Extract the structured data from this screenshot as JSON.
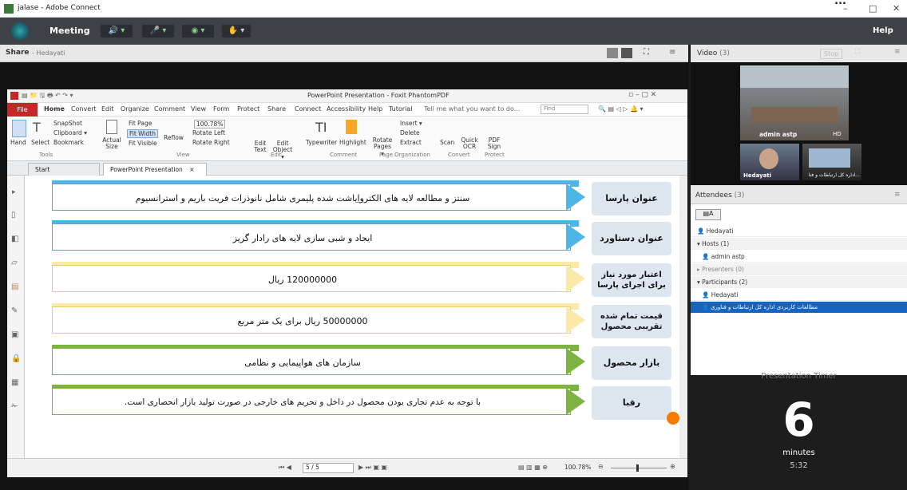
{
  "banner": {
    "text": "..."
  },
  "window": {
    "title": "jalase - Adobe Connect",
    "min": "–",
    "max": "□",
    "close": "✕"
  },
  "menubar": {
    "meeting": "Meeting",
    "help": "Help"
  },
  "share": {
    "title": "Share",
    "presenter": "- Hedayati"
  },
  "foxit": {
    "title": "PowerPoint Presentation - Foxit PhantomPDF",
    "tabs": [
      "File",
      "Home",
      "Convert",
      "Edit",
      "Organize",
      "Comment",
      "View",
      "Form",
      "Protect",
      "Share",
      "Connect",
      "Accessibility",
      "Help",
      "Tutorial"
    ],
    "tell_me": "Tell me what you want to do...",
    "find": "Find",
    "ribbon": {
      "hand": "Hand",
      "select": "Select",
      "snapshot": "SnapShot",
      "clipboard": "Clipboard ▾",
      "bookmark": "Bookmark",
      "actual_size": "Actual Size",
      "fit_page": "Fit Page",
      "fit_width": "Fit Width",
      "fit_visible": "Fit Visible",
      "reflow": "Reflow",
      "zoom": "100.78%",
      "rotate_left": "Rotate Left",
      "rotate_right": "Rotate Right",
      "edit_text": "Edit Text",
      "edit_object": "Edit Object ▾",
      "typewriter": "Typewriter",
      "highlight": "Highlight",
      "rotate_pages": "Rotate Pages ▾",
      "insert": "Insert ▾",
      "delete": "Delete",
      "extract": "Extract",
      "scan": "Scan",
      "quick_ocr": "Quick OCR",
      "pdf_sign": "PDF Sign",
      "groups": {
        "tools": "Tools",
        "view": "View",
        "edit": "Edit",
        "comment": "Comment",
        "page_org": "Page Organization",
        "convert": "Convert",
        "protect": "Protect"
      }
    },
    "doc_tabs": [
      "Start",
      "PowerPoint Presentation"
    ],
    "page_nav": "5 / 5",
    "zoom_status": "100.78%"
  },
  "slide": {
    "rows": [
      {
        "label": "عنوان پارسا",
        "text": "سنتز و مطالعه لایه های الکترواِیاشت شده پلیمری شامل نانوذرات فریت باریم و استرانسیوم",
        "theme": "blue"
      },
      {
        "label": "عنوان دستاورد",
        "text": "ایجاد و شبی سازی لایه های رادار گریز",
        "theme": "blue"
      },
      {
        "label": "اعتبار مورد نیاز برای اجرای پارسا",
        "text": "120000000 ریال",
        "theme": "yellow"
      },
      {
        "label": "قیمت تمام شده تقریبی محصول",
        "text": "50000000 ریال برای یک متر مربع",
        "theme": "yellow"
      },
      {
        "label": "بازار محصول",
        "text": "سازمان های هواپیمایی و نظامی",
        "theme": "green"
      },
      {
        "label": "رقبا",
        "text": "با توجه به عدم تجاری بودن محصول در داخل و تحریم های خارجی در صورت تولید بازار انحصاری است.",
        "theme": "green"
      }
    ]
  },
  "video": {
    "title": "Video",
    "count": "(3)",
    "stop": "Stop",
    "tiles": [
      {
        "name": "admin astp",
        "badge": "HD"
      },
      {
        "name": "Hedayati"
      },
      {
        "name": "...اداره کل ارتباطات و فنا"
      }
    ]
  },
  "attendees": {
    "title": "Attendees",
    "count": "(3)",
    "me": "Hedayati",
    "hosts_header": "Hosts (1)",
    "host": "admin astp",
    "presenters_header": "Presenters (0)",
    "participants_header": "Participants (2)",
    "participants": [
      "Hedayati",
      "مطالعات کاربردی اداره کل ارتباطات و فناوری"
    ]
  },
  "timer": {
    "header": "Presentation Timer",
    "value": "6",
    "unit": "minutes",
    "remaining": "5:32"
  },
  "colors": {
    "menubar": "#3e4247",
    "blue_bar": "#4db6e8",
    "yellow_bar": "#fbe9a8",
    "green_bar": "#7cb342",
    "label_bg": "#dde6ef"
  }
}
